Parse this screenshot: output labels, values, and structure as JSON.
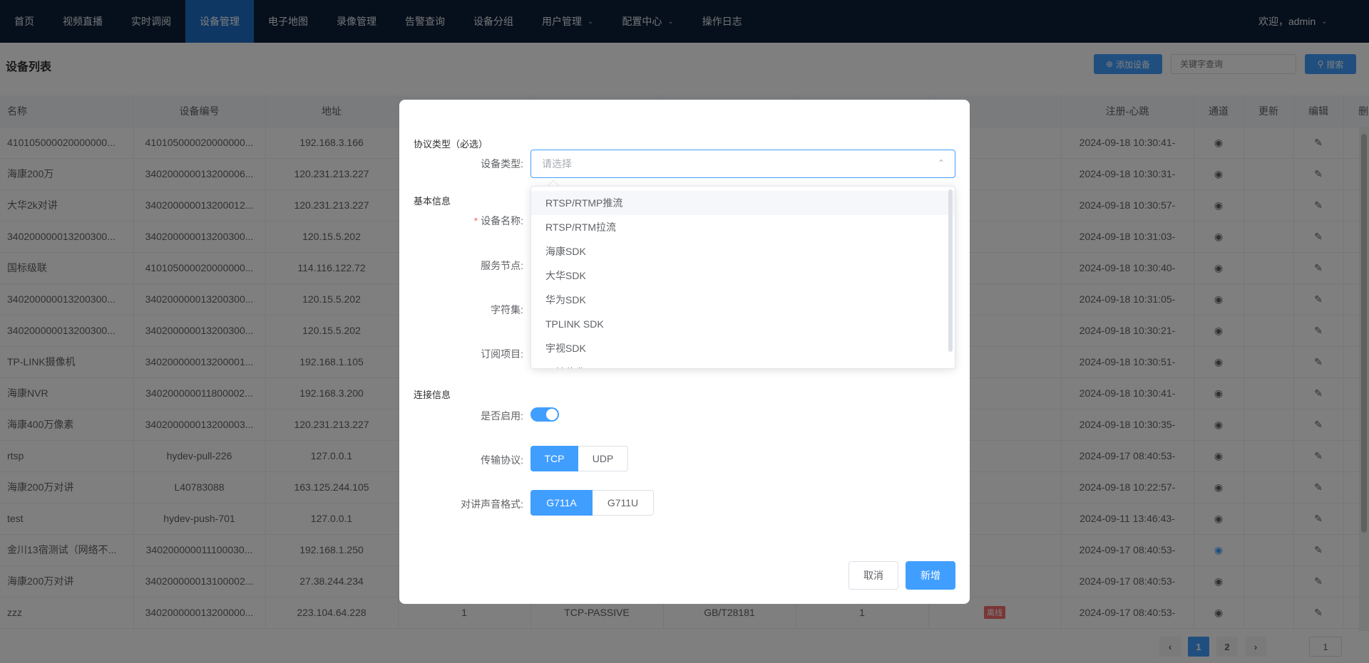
{
  "nav": {
    "items": [
      {
        "label": "首页"
      },
      {
        "label": "视频直播"
      },
      {
        "label": "实时调阅"
      },
      {
        "label": "设备管理"
      },
      {
        "label": "电子地图"
      },
      {
        "label": "录像管理"
      },
      {
        "label": "告警查询"
      },
      {
        "label": "设备分组"
      },
      {
        "label": "用户管理"
      },
      {
        "label": "配置中心"
      },
      {
        "label": "操作日志"
      }
    ],
    "active_index": 3,
    "user_label": "欢迎，admin"
  },
  "header": {
    "title": "设备列表",
    "add_button": "添加设备",
    "search_placeholder": "关键字查询",
    "search_button": "搜索"
  },
  "table": {
    "columns": [
      "名称",
      "设备编号",
      "地址",
      "注册-心跳",
      "通道",
      "更新",
      "编辑",
      "删除"
    ],
    "rows": [
      {
        "name": "410105000020000000...",
        "code": "410105000020000000...",
        "addr": "192.168.3.166",
        "reg": "2024-09-18 10:30:41-"
      },
      {
        "name": "海康200万",
        "code": "340200000013200006...",
        "addr": "120.231.213.227",
        "reg": "2024-09-18 10:30:31-"
      },
      {
        "name": "大华2k对讲",
        "code": "340200000013200012...",
        "addr": "120.231.213.227",
        "reg": "2024-09-18 10:30:57-"
      },
      {
        "name": "340200000013200300...",
        "code": "340200000013200300...",
        "addr": "120.15.5.202",
        "reg": "2024-09-18 10:31:03-"
      },
      {
        "name": "国标级联",
        "code": "410105000020000000...",
        "addr": "114.116.122.72",
        "reg": "2024-09-18 10:30:40-"
      },
      {
        "name": "340200000013200300...",
        "code": "340200000013200300...",
        "addr": "120.15.5.202",
        "reg": "2024-09-18 10:31:05-"
      },
      {
        "name": "340200000013200300...",
        "code": "340200000013200300...",
        "addr": "120.15.5.202",
        "reg": "2024-09-18 10:30:21-"
      },
      {
        "name": "TP-LINK摄像机",
        "code": "340200000013200001...",
        "addr": "192.168.1.105",
        "reg": "2024-09-18 10:30:51-"
      },
      {
        "name": "海康NVR",
        "code": "340200000011800002...",
        "addr": "192.168.3.200",
        "reg": "2024-09-18 10:30:41-"
      },
      {
        "name": "海康400万像素",
        "code": "340200000013200003...",
        "addr": "120.231.213.227",
        "reg": "2024-09-18 10:30:35-"
      },
      {
        "name": "rtsp",
        "code": "hydev-pull-226",
        "addr": "127.0.0.1",
        "reg": "2024-09-17 08:40:53-"
      },
      {
        "name": "海康200万对讲",
        "code": "L40783088",
        "addr": "163.125.244.105",
        "reg": "2024-09-18 10:22:57-"
      },
      {
        "name": "test",
        "code": "hydev-push-701",
        "addr": "127.0.0.1",
        "reg": "2024-09-11 13:46:43-"
      },
      {
        "name": "金川13宿测试（网络不...",
        "code": "340200000011100030...",
        "addr": "192.168.1.250",
        "reg": "2024-09-17 08:40:53-"
      },
      {
        "name": "海康200万对讲",
        "code": "340200000013100002...",
        "addr": "27.38.244.234",
        "reg": "2024-09-17 08:40:53-"
      },
      {
        "name": "zzz",
        "code": "340200000013200000...",
        "addr": "223.104.64.228",
        "reg": "2024-09-17 08:40:53-",
        "ch": "1",
        "transport": "TCP-PASSIVE",
        "proto": "GB/T28181",
        "count": "1",
        "status": "离线"
      }
    ]
  },
  "pagination": {
    "pages": [
      "1",
      "2"
    ],
    "current": "1",
    "jump_value": "1"
  },
  "dialog": {
    "protocol_section": "协议类型（必选）",
    "device_type_label": "设备类型:",
    "device_type_placeholder": "请选择",
    "dropdown_options": [
      "RTSP/RTMP推流",
      "RTSP/RTM拉流",
      "海康SDK",
      "大华SDK",
      "华为SDK",
      "TPLINK SDK",
      "宇视SDK",
      "天地伟业SDK"
    ],
    "basic_section": "基本信息",
    "device_name_label": "设备名称:",
    "service_node_label": "服务节点:",
    "charset_label": "字符集:",
    "subscribe_label": "订阅项目:",
    "connect_section": "连接信息",
    "enable_label": "是否启用:",
    "enabled": true,
    "transport_label": "传输协议:",
    "transport_options": [
      "TCP",
      "UDP"
    ],
    "audio_label": "对讲声音格式:",
    "audio_options": [
      "G711A",
      "G711U"
    ],
    "cancel_button": "取消",
    "add_button": "新增"
  },
  "colors": {
    "primary": "#409eff",
    "nav_bg": "#0d2139",
    "nav_active": "#1f6fc8",
    "danger": "#f56c6c"
  }
}
